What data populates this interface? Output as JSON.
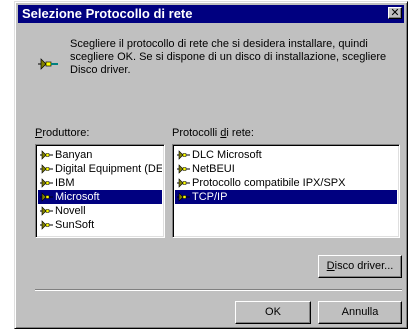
{
  "window": {
    "title": "Selezione Protocollo di rete",
    "close_symbol": "✕"
  },
  "intro": {
    "text": "Scegliere il protocollo di rete che si desidera installare, quindi scegliere OK. Se si dispone di un disco di installazione, scegliere Disco driver.",
    "icon": "network-cable-icon"
  },
  "manufacturers": {
    "label_accel": "P",
    "label_rest": "roduttore:",
    "items": [
      {
        "label": "Banyan",
        "selected": false
      },
      {
        "label": "Digital Equipment (DEC)",
        "selected": false
      },
      {
        "label": "IBM",
        "selected": false
      },
      {
        "label": "Microsoft",
        "selected": true
      },
      {
        "label": "Novell",
        "selected": false
      },
      {
        "label": "SunSoft",
        "selected": false
      }
    ]
  },
  "protocols": {
    "label_pre": "Protocolli ",
    "label_accel": "d",
    "label_rest": "i rete:",
    "items": [
      {
        "label": "DLC Microsoft",
        "selected": false
      },
      {
        "label": "NetBEUI",
        "selected": false
      },
      {
        "label": "Protocollo compatibile IPX/SPX",
        "selected": false
      },
      {
        "label": "TCP/IP",
        "selected": true
      }
    ]
  },
  "buttons": {
    "disk_accel": "D",
    "disk_rest": "isco driver...",
    "ok": "OK",
    "cancel": "Annulla"
  },
  "colors": {
    "titlebar": "#000080",
    "face": "#c0c0c0",
    "selection": "#000080"
  }
}
